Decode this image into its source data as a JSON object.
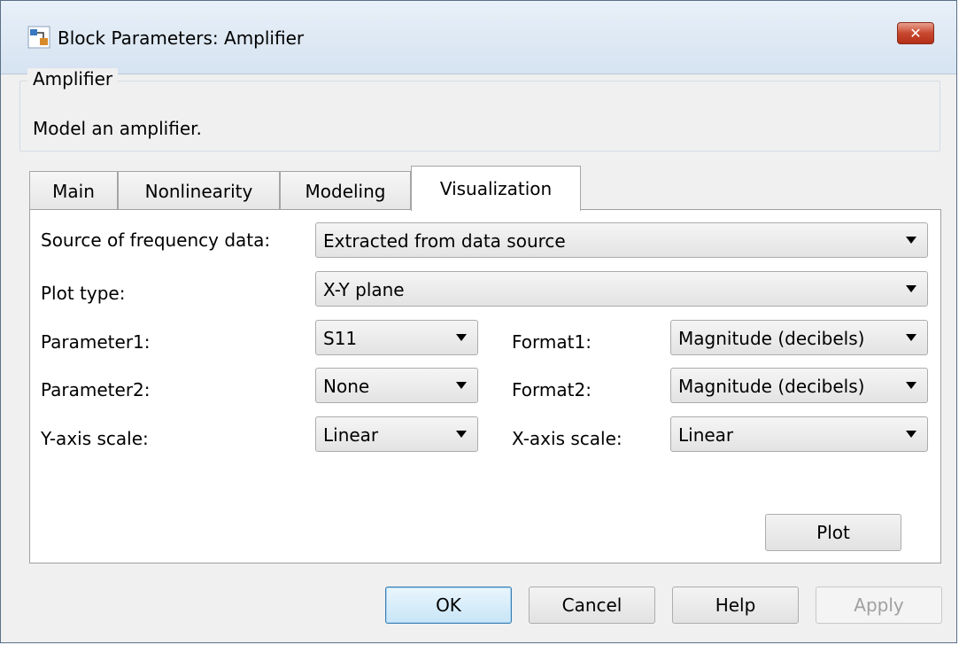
{
  "window": {
    "title": "Block Parameters: Amplifier",
    "close_icon": "close-icon"
  },
  "group": {
    "legend": "Amplifier",
    "description": "Model an amplifier."
  },
  "tabs": [
    {
      "label": "Main"
    },
    {
      "label": "Nonlinearity"
    },
    {
      "label": "Modeling"
    },
    {
      "label": "Visualization"
    }
  ],
  "active_tab": "Visualization",
  "form": {
    "source_label": "Source of frequency data:",
    "source_value": "Extracted from data source",
    "plot_type_label": "Plot type:",
    "plot_type_value": "X-Y plane",
    "param1_label": "Parameter1:",
    "param1_value": "S11",
    "format1_label": "Format1:",
    "format1_value": "Magnitude (decibels)",
    "param2_label": "Parameter2:",
    "param2_value": "None",
    "format2_label": "Format2:",
    "format2_value": "Magnitude (decibels)",
    "yscale_label": "Y-axis scale:",
    "yscale_value": "Linear",
    "xscale_label": "X-axis scale:",
    "xscale_value": "Linear",
    "plot_button": "Plot"
  },
  "footer": {
    "ok": "OK",
    "cancel": "Cancel",
    "help": "Help",
    "apply": "Apply"
  },
  "colors": {
    "accent": "#3c7fb1",
    "close": "#c8472e"
  }
}
